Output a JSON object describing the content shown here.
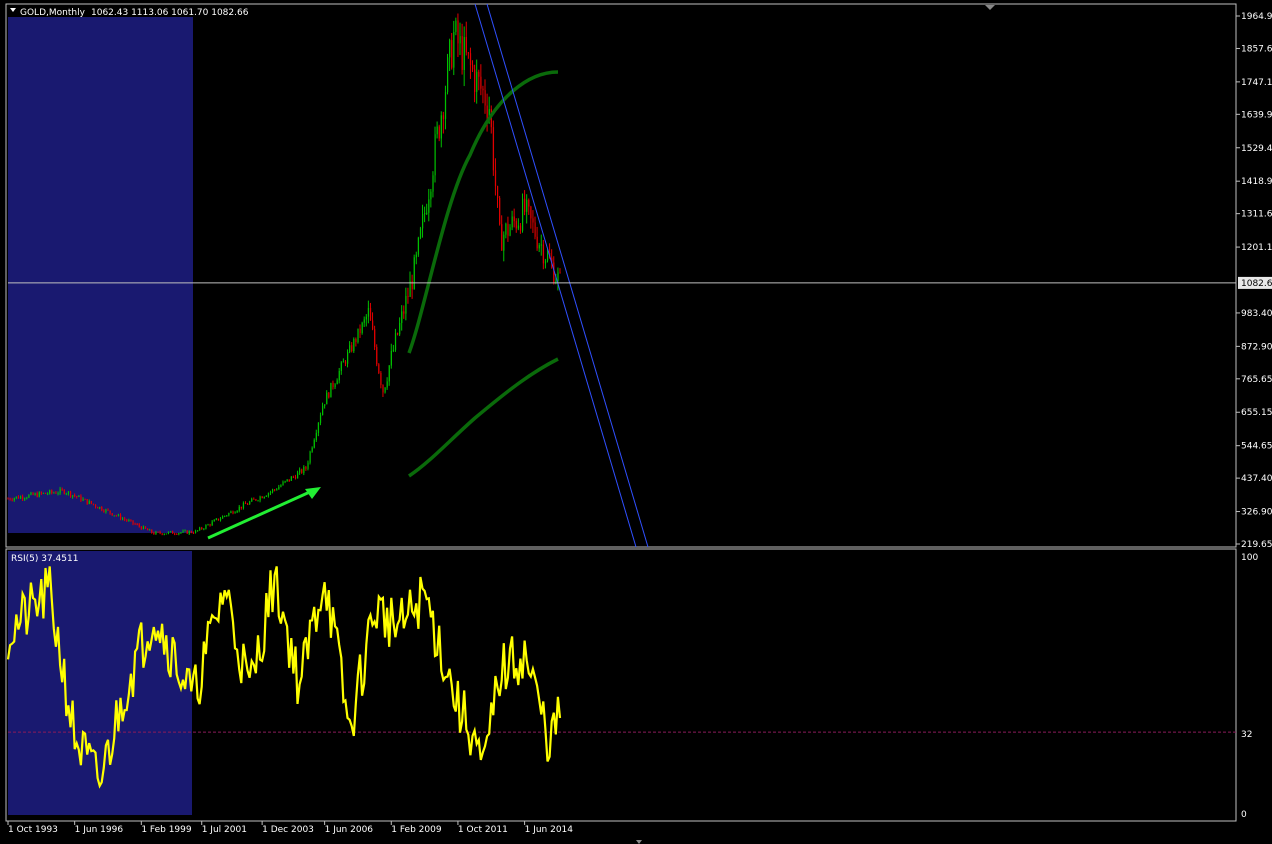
{
  "window": {
    "symbol": "GOLD,Monthly",
    "ohlc": "1062.43 1113.06 1061.70 1082.66",
    "current_price_label": "1082.6"
  },
  "rsi": {
    "title": "RSI(5) 37.4511",
    "levels": [
      "100",
      "32",
      "0"
    ],
    "level_value": 32
  },
  "colors": {
    "background": "#000000",
    "axis": "#c0c0c0",
    "bull": "#00c000",
    "bear": "#e00000",
    "shade": "#191970",
    "channel": "#3050ff",
    "curve": "#0a6a0a",
    "arrow": "#22ee33",
    "rsi_line": "#ffff00",
    "rsi_level": "#8b1a5a"
  },
  "price_axis": {
    "ticks": [
      "1964.9",
      "1857.6",
      "1747.15",
      "1639.9",
      "1529.4",
      "1418.9",
      "1311.6",
      "1201.1",
      "983.40",
      "872.90",
      "765.65",
      "655.15",
      "544.65",
      "437.40",
      "326.90",
      "219.65"
    ]
  },
  "time_axis": {
    "labels": [
      "1 Oct 1993",
      "1 Jun 1996",
      "1 Feb 1999",
      "1 Jul 2001",
      "1 Dec 2003",
      "1 Jun 2006",
      "1 Feb 2009",
      "1 Oct 2011",
      "1 Jun 2014"
    ]
  },
  "chart_data": {
    "type": "candlestick",
    "price_range": [
      219.65,
      1964.9
    ],
    "rsi_range": [
      0,
      100
    ],
    "price_series": [
      {
        "date": "1993-10",
        "close": 370
      },
      {
        "date": "1996-01",
        "close": 395
      },
      {
        "date": "1997-06",
        "close": 340
      },
      {
        "date": "1999-08",
        "close": 255
      },
      {
        "date": "2001-04",
        "close": 260
      },
      {
        "date": "2003-01",
        "close": 340
      },
      {
        "date": "2004-06",
        "close": 400
      },
      {
        "date": "2005-09",
        "close": 470
      },
      {
        "date": "2006-05",
        "close": 680
      },
      {
        "date": "2008-03",
        "close": 980
      },
      {
        "date": "2008-10",
        "close": 730
      },
      {
        "date": "2010-02",
        "close": 1150
      },
      {
        "date": "2011-08",
        "close": 1900
      },
      {
        "date": "2013-01",
        "close": 1670
      },
      {
        "date": "2013-06",
        "close": 1230
      },
      {
        "date": "2014-06",
        "close": 1320
      },
      {
        "date": "2015-11",
        "close": 1082.66
      }
    ],
    "rsi_series": [
      {
        "date": "1993-10",
        "value": 70
      },
      {
        "date": "1995-06",
        "value": 86
      },
      {
        "date": "1996-06",
        "value": 30
      },
      {
        "date": "1997-06",
        "value": 12
      },
      {
        "date": "1998-06",
        "value": 48
      },
      {
        "date": "1999-08",
        "value": 78
      },
      {
        "date": "2001-03",
        "value": 45
      },
      {
        "date": "2002-06",
        "value": 88
      },
      {
        "date": "2003-06",
        "value": 48
      },
      {
        "date": "2004-06",
        "value": 92
      },
      {
        "date": "2005-06",
        "value": 50
      },
      {
        "date": "2006-06",
        "value": 93
      },
      {
        "date": "2007-06",
        "value": 32
      },
      {
        "date": "2008-06",
        "value": 80
      },
      {
        "date": "2009-06",
        "value": 72
      },
      {
        "date": "2010-06",
        "value": 85
      },
      {
        "date": "2011-10",
        "value": 42
      },
      {
        "date": "2012-06",
        "value": 30
      },
      {
        "date": "2012-10",
        "value": 15
      },
      {
        "date": "2013-06",
        "value": 55
      },
      {
        "date": "2014-06",
        "value": 62
      },
      {
        "date": "2015-06",
        "value": 28
      },
      {
        "date": "2015-11",
        "value": 37.45
      }
    ],
    "current_price": 1082.66,
    "rsi_level": 32
  }
}
